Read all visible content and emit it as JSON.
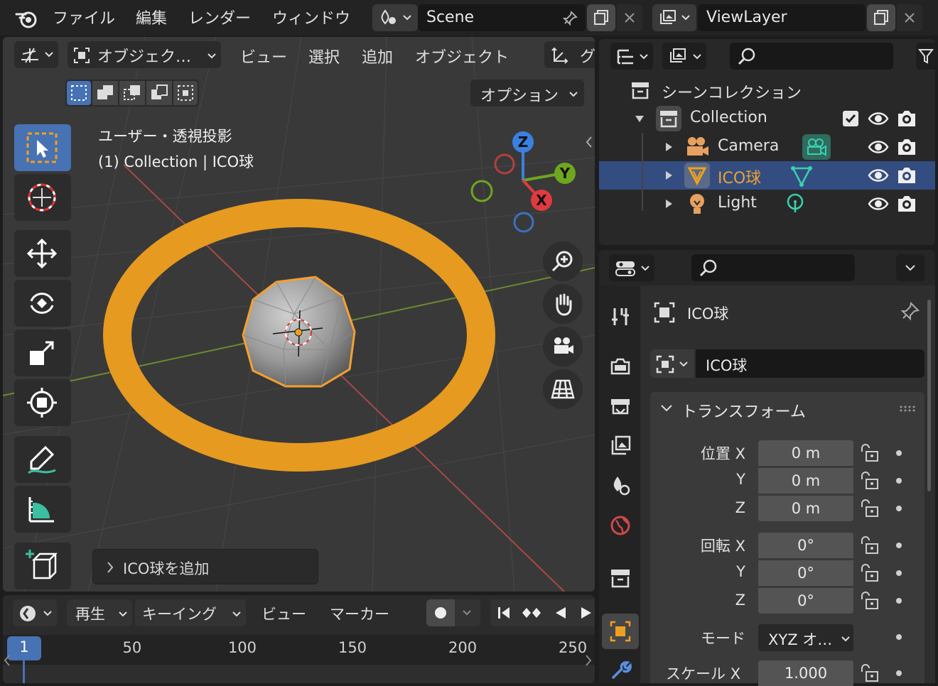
{
  "topbar": {
    "menus": [
      "ファイル",
      "編集",
      "レンダー",
      "ウィンドウ"
    ],
    "scene_name": "Scene",
    "view_layer_name": "ViewLayer"
  },
  "viewport": {
    "mode_label": "オブジェク…",
    "menus": [
      "ビュー",
      "選択",
      "追加",
      "オブジェクト"
    ],
    "cut_label": "グ",
    "options_label": "オプション",
    "view_name": "ユーザー・透視投影",
    "context_label": "(1) Collection | ICO球",
    "gizmo_axes": {
      "x": "X",
      "y": "Y",
      "z": "Z"
    },
    "operator_panel_label": "ICO球を追加",
    "colors": {
      "accent": "#4772b3",
      "selection": "#f0a020",
      "x_axis": "#e03a40",
      "y_axis": "#6fa61e",
      "z_axis": "#3a80e0"
    }
  },
  "outliner": {
    "scene_collection": "シーンコレクション",
    "collection": "Collection",
    "items": [
      {
        "name": "Camera",
        "type": "camera"
      },
      {
        "name": "ICO球",
        "type": "mesh",
        "selected": true
      },
      {
        "name": "Light",
        "type": "light"
      }
    ]
  },
  "properties": {
    "object_name": "ICO球",
    "datablock_name": "ICO球",
    "section_title": "トランスフォーム",
    "location": {
      "label": "位置",
      "x": "0 m",
      "y": "0 m",
      "z": "0 m"
    },
    "rotation": {
      "label": "回転",
      "x": "0°",
      "y": "0°",
      "z": "0°"
    },
    "axis_labels": {
      "x": "X",
      "y": "Y",
      "z": "Z"
    },
    "mode_label": "モード",
    "mode_value": "XYZ オ…",
    "scale": {
      "label": "スケール",
      "x": "1.000"
    }
  },
  "timeline": {
    "menus": [
      "再生",
      "キーイング",
      "ビュー",
      "マーカー"
    ],
    "current_frame": "1",
    "frames": [
      "50",
      "100",
      "150",
      "200",
      "250"
    ]
  }
}
